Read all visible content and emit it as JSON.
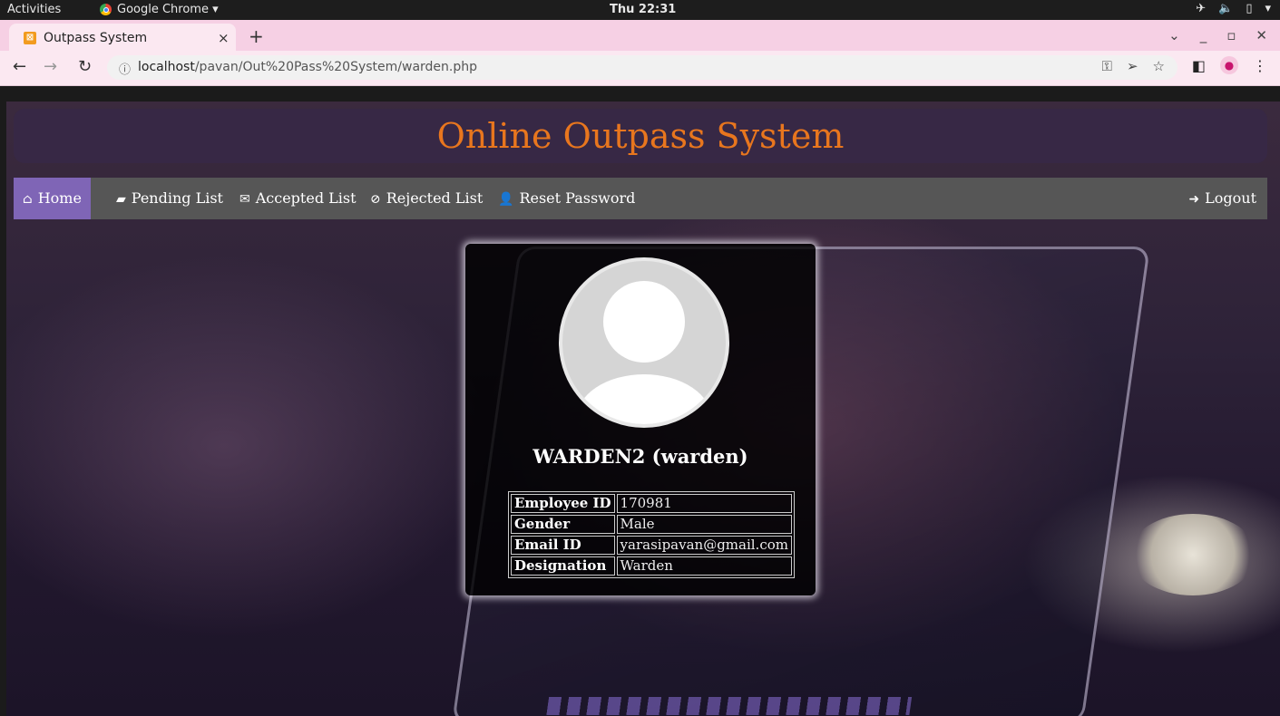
{
  "system_bar": {
    "activities": "Activities",
    "app_name": "Google Chrome ▾",
    "clock": "Thu 22:31",
    "tray_icons": [
      "airplane-icon",
      "volume-muted-icon",
      "battery-icon",
      "dropdown-icon"
    ]
  },
  "browser": {
    "tab_title": "Outpass System",
    "tab_close": "×",
    "new_tab": "+",
    "url_host": "localhost",
    "url_path": "/pavan/Out%20Pass%20System/warden.php",
    "window_controls": [
      "⌄",
      "_",
      "▫",
      "×"
    ]
  },
  "page": {
    "title": "Online Outpass System",
    "nav": {
      "home": "Home",
      "pending": "Pending List",
      "accepted": "Accepted List",
      "rejected": "Rejected List",
      "reset": "Reset Password",
      "logout": "Logout"
    },
    "profile": {
      "name": "WARDEN2 (warden)",
      "rows": [
        {
          "label": "Employee ID",
          "value": "170981"
        },
        {
          "label": "Gender",
          "value": "Male"
        },
        {
          "label": "Email ID",
          "value": "yarasipavan@gmail.com"
        },
        {
          "label": "Designation",
          "value": "Warden"
        }
      ]
    }
  },
  "colors": {
    "title": "#e8761e",
    "nav_bg": "#565656",
    "nav_active": "#7f65b6",
    "tab_strip": "#f6d0e4"
  }
}
